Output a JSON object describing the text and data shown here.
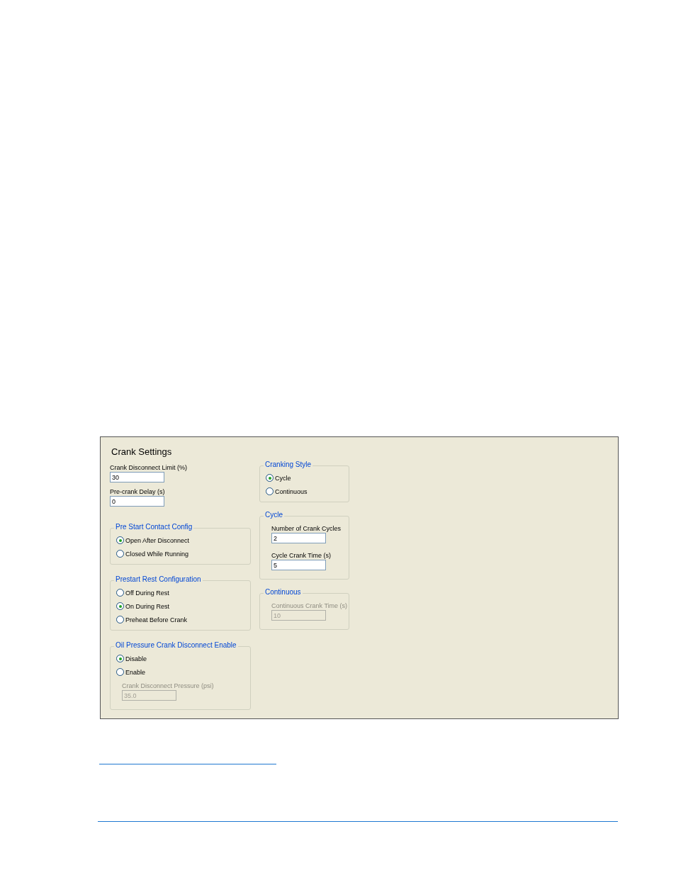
{
  "panel": {
    "title": "Crank Settings",
    "fields": [
      {
        "label": "Crank Disconnect Limit (%)",
        "value": "30",
        "disabled": false
      },
      {
        "label": "Pre-crank Delay (s)",
        "value": "0",
        "disabled": false
      }
    ],
    "left_groups": [
      {
        "title": "Pre Start Contact Config",
        "items": [
          {
            "kind": "radio",
            "label": "Open After Disconnect",
            "selected": true
          },
          {
            "kind": "radio",
            "label": "Closed While Running",
            "selected": false
          }
        ]
      },
      {
        "title": "Prestart Rest Configuration",
        "items": [
          {
            "kind": "radio",
            "label": "Off During Rest",
            "selected": false
          },
          {
            "kind": "radio",
            "label": "On During Rest",
            "selected": true
          },
          {
            "kind": "radio",
            "label": "Preheat Before Crank",
            "selected": false
          }
        ]
      },
      {
        "title": "Oil Pressure Crank Disconnect Enable",
        "items": [
          {
            "kind": "radio",
            "label": "Disable",
            "selected": true
          },
          {
            "kind": "radio",
            "label": "Enable",
            "selected": false
          },
          {
            "kind": "field",
            "label": "Crank Disconnect Pressure (psi)",
            "value": "35.0",
            "disabled": true
          }
        ]
      }
    ],
    "right_groups": [
      {
        "title": "Cranking Style",
        "items": [
          {
            "kind": "radio",
            "label": "Cycle",
            "selected": true
          },
          {
            "kind": "radio",
            "label": "Continuous",
            "selected": false
          }
        ]
      },
      {
        "title": "Cycle",
        "items": [
          {
            "kind": "field",
            "label": "Number of Crank Cycles",
            "value": "2",
            "disabled": false
          },
          {
            "kind": "field",
            "label": "Cycle Crank Time (s)",
            "value": "5",
            "disabled": false
          }
        ]
      },
      {
        "title": "Continuous",
        "items": [
          {
            "kind": "field",
            "label": "Continuous Crank Time (s)",
            "value": "10",
            "disabled": true
          }
        ]
      }
    ]
  }
}
